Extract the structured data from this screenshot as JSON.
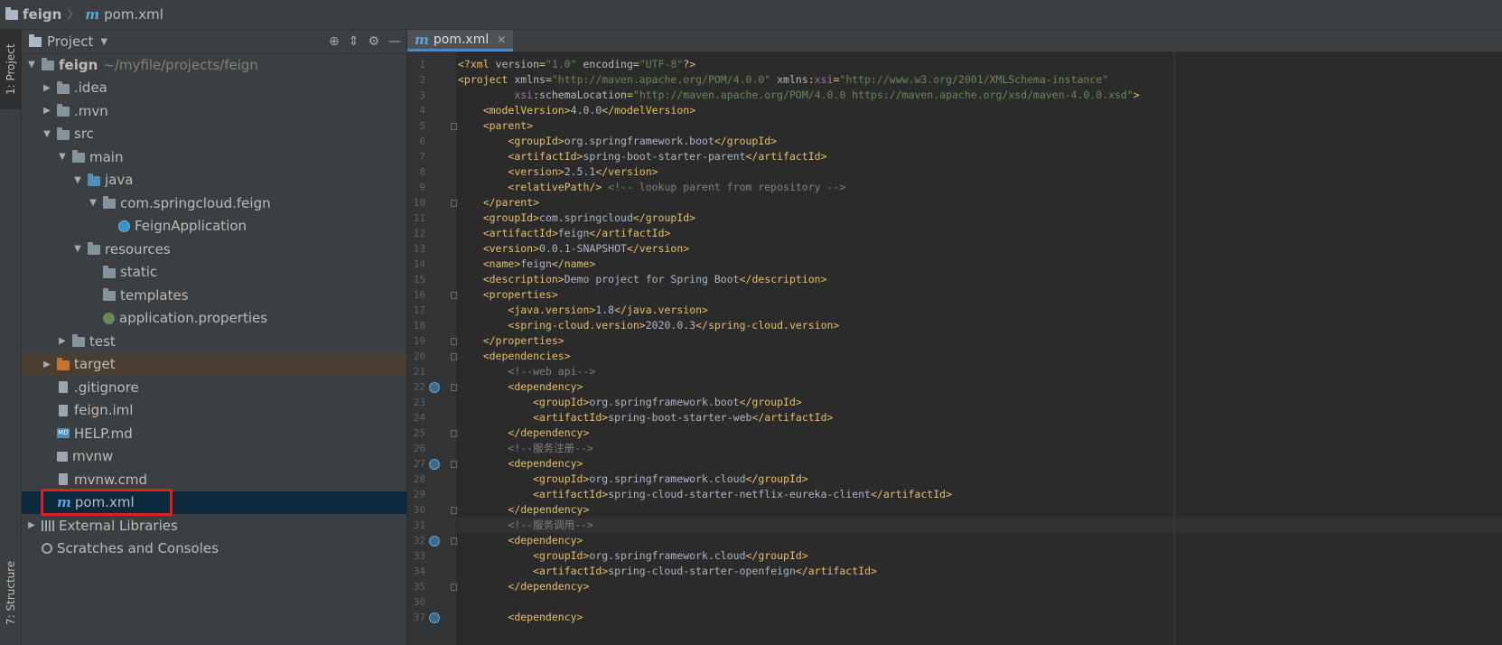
{
  "nav": {
    "project": "feign",
    "file": "pom.xml"
  },
  "left_strip": {
    "project_tab": "1: Project",
    "structure_tab": "7: Structure"
  },
  "panel": {
    "title": "Project"
  },
  "tree": [
    {
      "label": "feign",
      "note": "~/myfile/projects/feign",
      "indent": 0,
      "arrow": "▼",
      "icon": "folder",
      "bold": true
    },
    {
      "label": ".idea",
      "indent": 1,
      "arrow": "▶",
      "icon": "folder"
    },
    {
      "label": ".mvn",
      "indent": 1,
      "arrow": "▶",
      "icon": "folder"
    },
    {
      "label": "src",
      "indent": 1,
      "arrow": "▼",
      "icon": "folder"
    },
    {
      "label": "main",
      "indent": 2,
      "arrow": "▼",
      "icon": "folder"
    },
    {
      "label": "java",
      "indent": 3,
      "arrow": "▼",
      "icon": "folder-blue"
    },
    {
      "label": "com.springcloud.feign",
      "indent": 4,
      "arrow": "▼",
      "icon": "package"
    },
    {
      "label": "FeignApplication",
      "indent": 5,
      "arrow": "",
      "icon": "class"
    },
    {
      "label": "resources",
      "indent": 3,
      "arrow": "▼",
      "icon": "folder-resources"
    },
    {
      "label": "static",
      "indent": 4,
      "arrow": "",
      "icon": "folder"
    },
    {
      "label": "templates",
      "indent": 4,
      "arrow": "",
      "icon": "folder"
    },
    {
      "label": "application.properties",
      "indent": 4,
      "arrow": "",
      "icon": "properties"
    },
    {
      "label": "test",
      "indent": 2,
      "arrow": "▶",
      "icon": "folder"
    },
    {
      "label": "target",
      "indent": 1,
      "arrow": "▶",
      "icon": "folder-orange",
      "state": "highlight"
    },
    {
      "label": ".gitignore",
      "indent": 1,
      "arrow": "",
      "icon": "file"
    },
    {
      "label": "feign.iml",
      "indent": 1,
      "arrow": "",
      "icon": "file"
    },
    {
      "label": "HELP.md",
      "indent": 1,
      "arrow": "",
      "icon": "md"
    },
    {
      "label": "mvnw",
      "indent": 1,
      "arrow": "",
      "icon": "mvn"
    },
    {
      "label": "mvnw.cmd",
      "indent": 1,
      "arrow": "",
      "icon": "file"
    },
    {
      "label": "pom.xml",
      "indent": 1,
      "arrow": "",
      "icon": "maven",
      "state": "selected"
    },
    {
      "label": "External Libraries",
      "indent": 0,
      "arrow": "▶",
      "icon": "library"
    },
    {
      "label": "Scratches and Consoles",
      "indent": 0,
      "arrow": "",
      "icon": "scratch"
    }
  ],
  "editor": {
    "tab_label": "pom.xml",
    "current_line": 31,
    "gutter_marks": [
      22,
      27,
      32,
      37
    ],
    "lines": [
      [
        [
          "tg",
          "<?xml "
        ],
        [
          "at",
          "version"
        ],
        [
          "tg",
          "="
        ],
        [
          "av",
          "\"1.0\""
        ],
        [
          "at",
          " encoding"
        ],
        [
          "tg",
          "="
        ],
        [
          "av",
          "\"UTF-8\""
        ],
        [
          "tg",
          "?>"
        ]
      ],
      [
        [
          "tg",
          "<project "
        ],
        [
          "at",
          "xmlns"
        ],
        [
          "tg",
          "="
        ],
        [
          "av",
          "\"http://maven.apache.org/POM/4.0.0\""
        ],
        [
          "at",
          " xmlns"
        ],
        [
          "tg",
          ":"
        ],
        [
          "ns",
          "xsi"
        ],
        [
          "tg",
          "="
        ],
        [
          "av",
          "\"http://www.w3.org/2001/XMLSchema-instance\""
        ]
      ],
      [
        [
          "txt",
          "         "
        ],
        [
          "ns",
          "xsi"
        ],
        [
          "tg",
          ":"
        ],
        [
          "at",
          "schemaLocation"
        ],
        [
          "tg",
          "="
        ],
        [
          "av",
          "\"http://maven.apache.org/POM/4.0.0 https://maven.apache.org/xsd/maven-4.0.0.xsd\""
        ],
        [
          "tg",
          ">"
        ]
      ],
      [
        [
          "txt",
          "    "
        ],
        [
          "tg",
          "<modelVersion>"
        ],
        [
          "txt",
          "4.0.0"
        ],
        [
          "tg",
          "</modelVersion>"
        ]
      ],
      [
        [
          "txt",
          "    "
        ],
        [
          "tg",
          "<parent>"
        ]
      ],
      [
        [
          "txt",
          "        "
        ],
        [
          "tg",
          "<groupId>"
        ],
        [
          "txt",
          "org.springframework.boot"
        ],
        [
          "tg",
          "</groupId>"
        ]
      ],
      [
        [
          "txt",
          "        "
        ],
        [
          "tg",
          "<artifactId>"
        ],
        [
          "txt",
          "spring-boot-starter-parent"
        ],
        [
          "tg",
          "</artifactId>"
        ]
      ],
      [
        [
          "txt",
          "        "
        ],
        [
          "tg",
          "<version>"
        ],
        [
          "txt",
          "2.5.1"
        ],
        [
          "tg",
          "</version>"
        ]
      ],
      [
        [
          "txt",
          "        "
        ],
        [
          "tg",
          "<relativePath/>"
        ],
        [
          "cm",
          " <!-- lookup parent from repository -->"
        ]
      ],
      [
        [
          "txt",
          "    "
        ],
        [
          "tg",
          "</parent>"
        ]
      ],
      [
        [
          "txt",
          "    "
        ],
        [
          "tg",
          "<groupId>"
        ],
        [
          "txt",
          "com.springcloud"
        ],
        [
          "tg",
          "</groupId>"
        ]
      ],
      [
        [
          "txt",
          "    "
        ],
        [
          "tg",
          "<artifactId>"
        ],
        [
          "txt",
          "feign"
        ],
        [
          "tg",
          "</artifactId>"
        ]
      ],
      [
        [
          "txt",
          "    "
        ],
        [
          "tg",
          "<version>"
        ],
        [
          "txt",
          "0.0.1-SNAPSHOT"
        ],
        [
          "tg",
          "</version>"
        ]
      ],
      [
        [
          "txt",
          "    "
        ],
        [
          "tg",
          "<name>"
        ],
        [
          "txt",
          "feign"
        ],
        [
          "tg",
          "</name>"
        ]
      ],
      [
        [
          "txt",
          "    "
        ],
        [
          "tg",
          "<description>"
        ],
        [
          "txt",
          "Demo project for Spring Boot"
        ],
        [
          "tg",
          "</description>"
        ]
      ],
      [
        [
          "txt",
          "    "
        ],
        [
          "tg",
          "<properties>"
        ]
      ],
      [
        [
          "txt",
          "        "
        ],
        [
          "tg",
          "<java.version>"
        ],
        [
          "txt",
          "1.8"
        ],
        [
          "tg",
          "</java.version>"
        ]
      ],
      [
        [
          "txt",
          "        "
        ],
        [
          "tg",
          "<spring-cloud.version>"
        ],
        [
          "txt",
          "2020.0.3"
        ],
        [
          "tg",
          "</spring-cloud.version>"
        ]
      ],
      [
        [
          "txt",
          "    "
        ],
        [
          "tg",
          "</properties>"
        ]
      ],
      [
        [
          "txt",
          "    "
        ],
        [
          "tg",
          "<dependencies>"
        ]
      ],
      [
        [
          "txt",
          "        "
        ],
        [
          "cm",
          "<!--web api-->"
        ]
      ],
      [
        [
          "txt",
          "        "
        ],
        [
          "tg",
          "<dependency>"
        ]
      ],
      [
        [
          "txt",
          "            "
        ],
        [
          "tg",
          "<groupId>"
        ],
        [
          "txt",
          "org.springframework.boot"
        ],
        [
          "tg",
          "</groupId>"
        ]
      ],
      [
        [
          "txt",
          "            "
        ],
        [
          "tg",
          "<artifactId>"
        ],
        [
          "txt",
          "spring-boot-starter-web"
        ],
        [
          "tg",
          "</artifactId>"
        ]
      ],
      [
        [
          "txt",
          "        "
        ],
        [
          "tg",
          "</dependency>"
        ]
      ],
      [
        [
          "txt",
          "        "
        ],
        [
          "cm",
          "<!--服务注册-->"
        ]
      ],
      [
        [
          "txt",
          "        "
        ],
        [
          "tg",
          "<dependency>"
        ]
      ],
      [
        [
          "txt",
          "            "
        ],
        [
          "tg",
          "<groupId>"
        ],
        [
          "txt",
          "org.springframework.cloud"
        ],
        [
          "tg",
          "</groupId>"
        ]
      ],
      [
        [
          "txt",
          "            "
        ],
        [
          "tg",
          "<artifactId>"
        ],
        [
          "txt",
          "spring-cloud-starter-netflix-eureka-client"
        ],
        [
          "tg",
          "</artifactId>"
        ]
      ],
      [
        [
          "txt",
          "        "
        ],
        [
          "tg",
          "</dependency>"
        ]
      ],
      [
        [
          "txt",
          "        "
        ],
        [
          "cm",
          "<!--服务调用-->"
        ]
      ],
      [
        [
          "txt",
          "        "
        ],
        [
          "tg",
          "<dependency>"
        ]
      ],
      [
        [
          "txt",
          "            "
        ],
        [
          "tg",
          "<groupId>"
        ],
        [
          "txt",
          "org.springframework.cloud"
        ],
        [
          "tg",
          "</groupId>"
        ]
      ],
      [
        [
          "txt",
          "            "
        ],
        [
          "tg",
          "<artifactId>"
        ],
        [
          "txt",
          "spring-cloud-starter-openfeign"
        ],
        [
          "tg",
          "</artifactId>"
        ]
      ],
      [
        [
          "txt",
          "        "
        ],
        [
          "tg",
          "</dependency>"
        ]
      ],
      [
        [
          "txt",
          ""
        ]
      ],
      [
        [
          "txt",
          "        "
        ],
        [
          "tg",
          "<dependency>"
        ]
      ]
    ]
  }
}
